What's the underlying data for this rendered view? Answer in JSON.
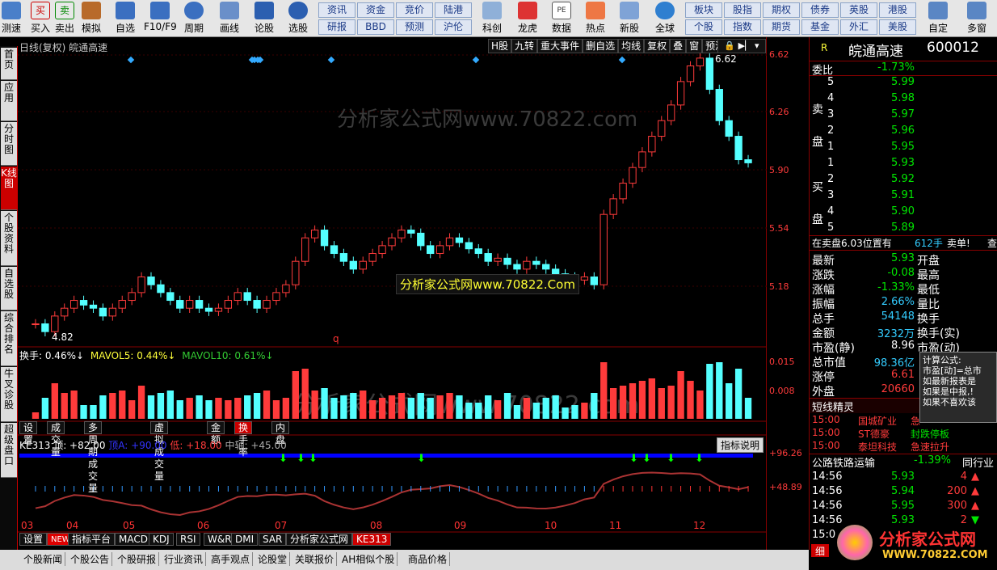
{
  "toolbar": {
    "items": [
      {
        "label": "测速",
        "icon": "speed-icon"
      },
      {
        "label": "买入",
        "icon": "buy-icon"
      },
      {
        "label": "卖出",
        "icon": "sell-icon"
      },
      {
        "label": "模拟",
        "icon": "hammer-icon"
      },
      {
        "label": "自选",
        "icon": "star-icon"
      },
      {
        "label": "F10/F9",
        "icon": "f10-icon"
      },
      {
        "label": "周期",
        "icon": "clock-icon"
      },
      {
        "label": "画线",
        "icon": "pen-icon"
      },
      {
        "label": "论股",
        "icon": "discuss-icon"
      },
      {
        "label": "选股",
        "icon": "select-icon"
      }
    ],
    "grid": [
      [
        "资讯",
        "资金",
        "竞价",
        "陆港"
      ],
      [
        "研报",
        "BBD",
        "预测",
        "沪伦"
      ]
    ],
    "items2": [
      {
        "label": "科创",
        "icon": "chart-icon"
      },
      {
        "label": "龙虎",
        "icon": "dragon-icon"
      },
      {
        "label": "数据",
        "icon": "pe-icon"
      },
      {
        "label": "热点",
        "icon": "hot-icon"
      },
      {
        "label": "新股",
        "icon": "newstock-icon"
      },
      {
        "label": "全球",
        "icon": "globe-icon"
      }
    ],
    "grid2": [
      [
        "板块",
        "股指",
        "期权",
        "债券",
        "英股",
        "港股"
      ],
      [
        "个股",
        "指数",
        "期货",
        "基金",
        "外汇",
        "美股"
      ]
    ],
    "right": [
      {
        "label": "自定",
        "icon": "custom-icon"
      },
      {
        "label": "多窗",
        "icon": "windows-icon"
      }
    ]
  },
  "sidebar": [
    "首页",
    "应用",
    "分时图",
    "K线图",
    "个股资料",
    "自选股",
    "综合排名",
    "牛叉诊股",
    "超级盘口"
  ],
  "chart_header": {
    "title": "日线(复权) 皖通高速",
    "buttons": [
      "H股",
      "九转",
      "重大事件",
      "删自选",
      "均线",
      "复权",
      "叠",
      "窗",
      "预测"
    ]
  },
  "watermark": "分析家公式网www.70822.com",
  "watermark2": "分析家公式网www.70822.Com",
  "high_label": "6.62",
  "low_label": "4.82",
  "price_axis": [
    "6.62",
    "6.26",
    "5.90",
    "5.54",
    "5.18"
  ],
  "volume": {
    "title": "换手: 0.46%↓",
    "ma5": "MAVOL5: 0.44%↓",
    "ma10": "MAVOL10: 0.61%↓",
    "axis": [
      "0.015",
      "0.008"
    ]
  },
  "mid_tabs": [
    "设置",
    "成交量",
    "多周期成交量",
    "虚拟成交量",
    "金额",
    "换手率",
    "内盘"
  ],
  "indicator": {
    "name": "KE313",
    "top": "顶: +82.00",
    "mid": "顶A: +90.00",
    "low": "低: +18.00",
    "axis": "中轴: +45.00",
    "explain": "指标说明",
    "axis_right": [
      "+96.26",
      "+48.89"
    ]
  },
  "months": [
    "03",
    "04",
    "05",
    "06",
    "07",
    "08",
    "09",
    "10",
    "11",
    "12"
  ],
  "bottom_tabs": [
    "设置",
    "NEW",
    "指标平台",
    "MACD",
    "KDJ",
    "RSI",
    "W&R",
    "DMI",
    "SAR",
    "分析家公式网",
    "KE313"
  ],
  "news_tabs": [
    "个股新闻",
    "个股公告",
    "个股研报",
    "行业资讯",
    "高手观点",
    "论股堂",
    "关联报价",
    "AH相似个股",
    "商品价格"
  ],
  "quote": {
    "r": "R",
    "name": "皖通高速",
    "code": "600012",
    "weibi_label": "委比",
    "weibi": "-1.73%",
    "sell_label": [
      "卖",
      "盘"
    ],
    "buy_label": [
      "买",
      "盘"
    ],
    "asks": [
      {
        "n": "5",
        "p": "5.99"
      },
      {
        "n": "4",
        "p": "5.98"
      },
      {
        "n": "3",
        "p": "5.97"
      },
      {
        "n": "2",
        "p": "5.96"
      },
      {
        "n": "1",
        "p": "5.95"
      }
    ],
    "bids": [
      {
        "n": "1",
        "p": "5.93"
      },
      {
        "n": "2",
        "p": "5.92"
      },
      {
        "n": "3",
        "p": "5.91"
      },
      {
        "n": "4",
        "p": "5.90"
      },
      {
        "n": "5",
        "p": "5.89"
      }
    ],
    "ask_note": "在卖盘6.03位置有",
    "ask_qty": "612手",
    "ask_word": "卖单!",
    "ask_query": "查",
    "stats": [
      {
        "l": "最新",
        "v": "5.93",
        "c": "grn",
        "r": "开盘"
      },
      {
        "l": "涨跌",
        "v": "-0.08",
        "c": "grn",
        "r": "最高"
      },
      {
        "l": "涨幅",
        "v": "-1.33%",
        "c": "grn",
        "r": "最低"
      },
      {
        "l": "振幅",
        "v": "2.66%",
        "c": "cyn",
        "r": "量比"
      },
      {
        "l": "总手",
        "v": "54148",
        "c": "cyn",
        "r": "换手"
      },
      {
        "l": "金额",
        "v": "3232万",
        "c": "cyn",
        "r": "换手(实)"
      },
      {
        "l": "市盈(静)",
        "v": "8.96",
        "c": "wht",
        "r": "市盈(动)"
      },
      {
        "l": "总市值",
        "v": "98.36亿",
        "c": "cyn",
        "r": ""
      },
      {
        "l": "涨停",
        "v": "6.61",
        "c": "red",
        "r": ""
      },
      {
        "l": "外盘",
        "v": "20660",
        "c": "red",
        "r": ""
      }
    ],
    "short_title": "短线精灵",
    "short": [
      {
        "t": "15:00",
        "n": "国城矿业",
        "e": "急"
      },
      {
        "t": "15:00",
        "n": "ST德豪",
        "e": "封跌停板"
      },
      {
        "t": "15:00",
        "n": "泰坦科技",
        "e": "急速拉升"
      }
    ],
    "sector": "公路铁路运输",
    "sector_pct": "-1.39%",
    "sector_btn": "同行业",
    "ticks": [
      {
        "t": "14:56",
        "p": "5.93",
        "q": "4",
        "d": "up"
      },
      {
        "t": "14:56",
        "p": "5.94",
        "q": "200",
        "d": "up"
      },
      {
        "t": "14:56",
        "p": "5.95",
        "q": "300",
        "d": "up"
      },
      {
        "t": "14:56",
        "p": "5.93",
        "q": "2",
        "d": "down"
      },
      {
        "t": "15:0",
        "p": "",
        "q": "",
        "d": ""
      }
    ],
    "bottom_btn": "细"
  },
  "tooltip": {
    "title": "计算公式:",
    "lines": [
      "市盈[动]=总市",
      "如最新报表是",
      "如果是中报,!",
      "如果不喜欢该"
    ]
  },
  "logo": {
    "title": "分析家公式网",
    "url": "WWW.70822.COM"
  },
  "chart_data": {
    "type": "candlestick",
    "title": "日线(复权) 皖通高速",
    "x_months": [
      "03",
      "04",
      "05",
      "06",
      "07",
      "08",
      "09",
      "10",
      "11",
      "12"
    ],
    "ylim": [
      4.82,
      6.62
    ],
    "close": [
      4.9,
      4.85,
      4.95,
      5.0,
      5.05,
      5.02,
      5.0,
      4.95,
      5.0,
      5.05,
      5.1,
      5.2,
      5.15,
      5.1,
      5.05,
      5.0,
      5.05,
      5.0,
      4.98,
      5.0,
      5.05,
      5.1,
      5.05,
      5.0,
      5.05,
      5.1,
      5.15,
      5.3,
      5.45,
      5.5,
      5.4,
      5.35,
      5.3,
      5.25,
      5.3,
      5.35,
      5.4,
      5.45,
      5.5,
      5.48,
      5.4,
      5.35,
      5.4,
      5.45,
      5.42,
      5.38,
      5.35,
      5.3,
      5.32,
      5.28,
      5.25,
      5.3,
      5.28,
      5.25,
      5.22,
      5.2,
      5.18,
      5.2,
      5.15,
      5.6,
      5.7,
      5.8,
      5.9,
      6.0,
      6.1,
      6.2,
      6.3,
      6.45,
      6.55,
      6.6,
      6.4,
      6.2,
      6.1,
      5.95,
      5.93
    ]
  }
}
